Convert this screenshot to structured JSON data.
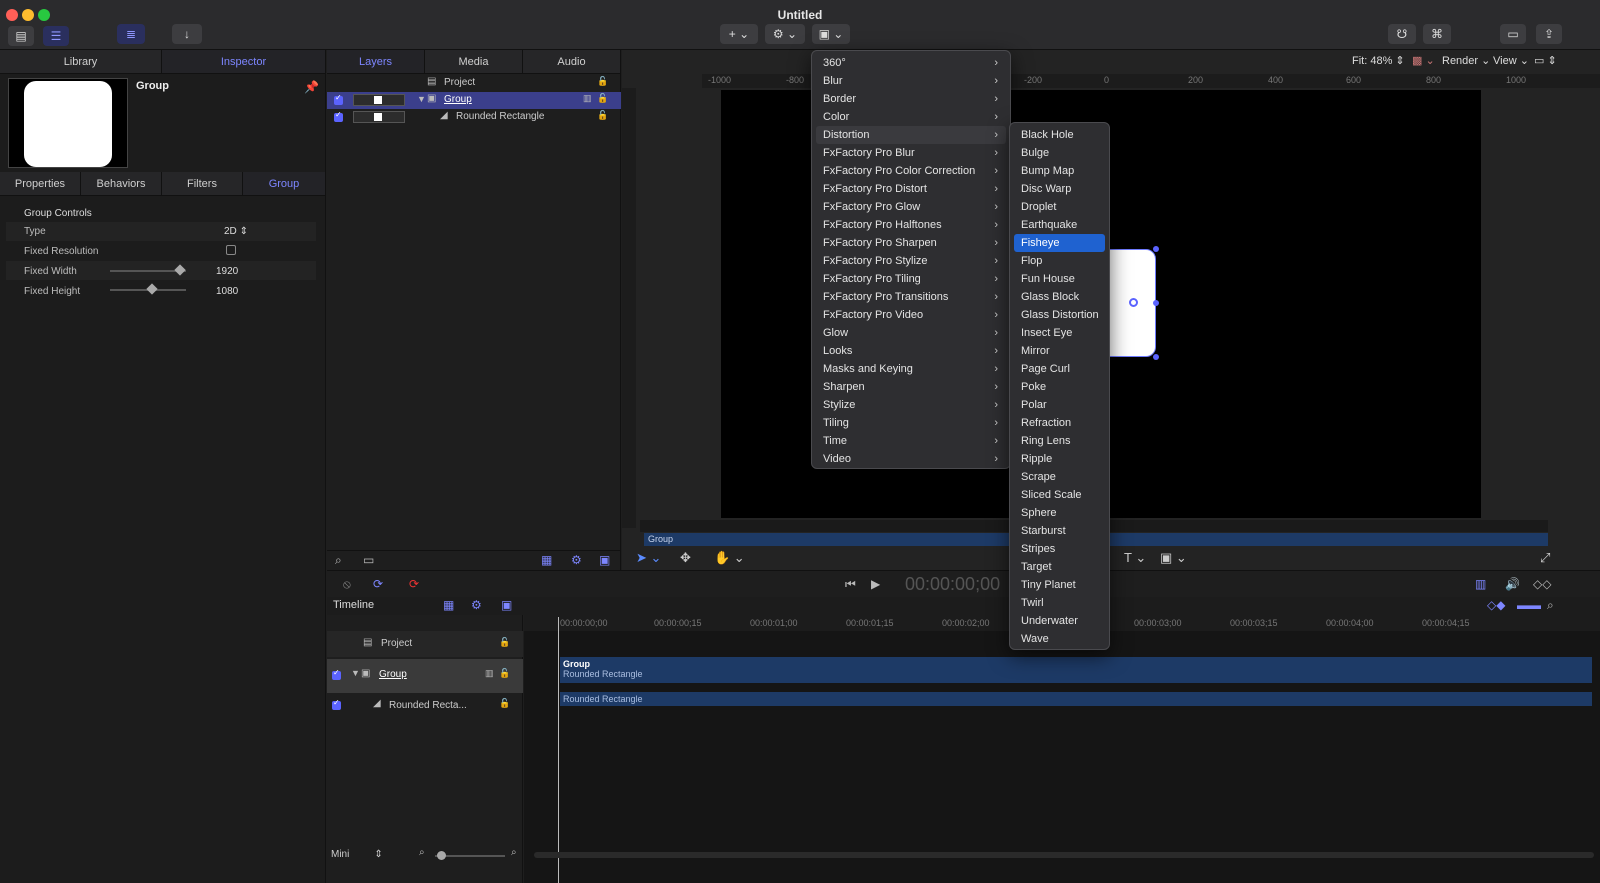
{
  "window": {
    "title": "Untitled"
  },
  "toolbar": {
    "add_label": "+",
    "view_zoom": "Fit: 48%",
    "render_label": "Render",
    "view_label": "View"
  },
  "left_tabs": {
    "library": "Library",
    "inspector": "Inspector"
  },
  "inspector": {
    "object_name": "Group",
    "subtabs": [
      "Properties",
      "Behaviors",
      "Filters",
      "Group"
    ],
    "section_title": "Group Controls",
    "type_label": "Type",
    "type_value": "2D",
    "fixed_resolution_label": "Fixed Resolution",
    "fixed_width_label": "Fixed Width",
    "fixed_width_value": "1920",
    "fixed_width_fraction": 0.92,
    "fixed_height_label": "Fixed Height",
    "fixed_height_value": "1080",
    "fixed_height_fraction": 0.55
  },
  "layers_tabs": {
    "layers": "Layers",
    "media": "Media",
    "audio": "Audio"
  },
  "layers": {
    "project": "Project",
    "group": "Group",
    "rect": "Rounded Rectangle"
  },
  "canvas": {
    "ruler_top": [
      "-1000",
      "-800",
      "-200",
      "0",
      "200",
      "400",
      "600",
      "800",
      "1000"
    ],
    "mini_timeline_label": "Group"
  },
  "transport": {
    "timecode": "00:00:00;00"
  },
  "timeline": {
    "title": "Timeline",
    "project": "Project",
    "group": "Group",
    "rect_short": "Rounded Recta...",
    "ruler": [
      "00:00:00;00",
      "00:00:00;15",
      "00:00:01;00",
      "00:00:01;15",
      "00:00:02;00",
      "00:00:03;00",
      "00:00:03;15",
      "00:00:04;00",
      "00:00:04;15"
    ],
    "clip_group": "Group",
    "clip_group_sub": "Rounded Rectangle",
    "clip_rect": "Rounded Rectangle",
    "zoom_mode": "Mini"
  },
  "filters_menu": [
    "360°",
    "Blur",
    "Border",
    "Color",
    "Distortion",
    "FxFactory Pro Blur",
    "FxFactory Pro Color Correction",
    "FxFactory Pro Distort",
    "FxFactory Pro Glow",
    "FxFactory Pro Halftones",
    "FxFactory Pro Sharpen",
    "FxFactory Pro Stylize",
    "FxFactory Pro Tiling",
    "FxFactory Pro Transitions",
    "FxFactory Pro Video",
    "Glow",
    "Looks",
    "Masks and Keying",
    "Sharpen",
    "Stylize",
    "Tiling",
    "Time",
    "Video"
  ],
  "distortion_menu": [
    "Black Hole",
    "Bulge",
    "Bump Map",
    "Disc Warp",
    "Droplet",
    "Earthquake",
    "Fisheye",
    "Flop",
    "Fun House",
    "Glass Block",
    "Glass Distortion",
    "Insect Eye",
    "Mirror",
    "Page Curl",
    "Poke",
    "Polar",
    "Refraction",
    "Ring Lens",
    "Ripple",
    "Scrape",
    "Sliced Scale",
    "Sphere",
    "Starburst",
    "Stripes",
    "Target",
    "Tiny Planet",
    "Twirl",
    "Underwater",
    "Wave"
  ],
  "colors": {
    "accent": "#5b63ff",
    "selection": "#1f62d0",
    "clip": "#1d3a66"
  }
}
